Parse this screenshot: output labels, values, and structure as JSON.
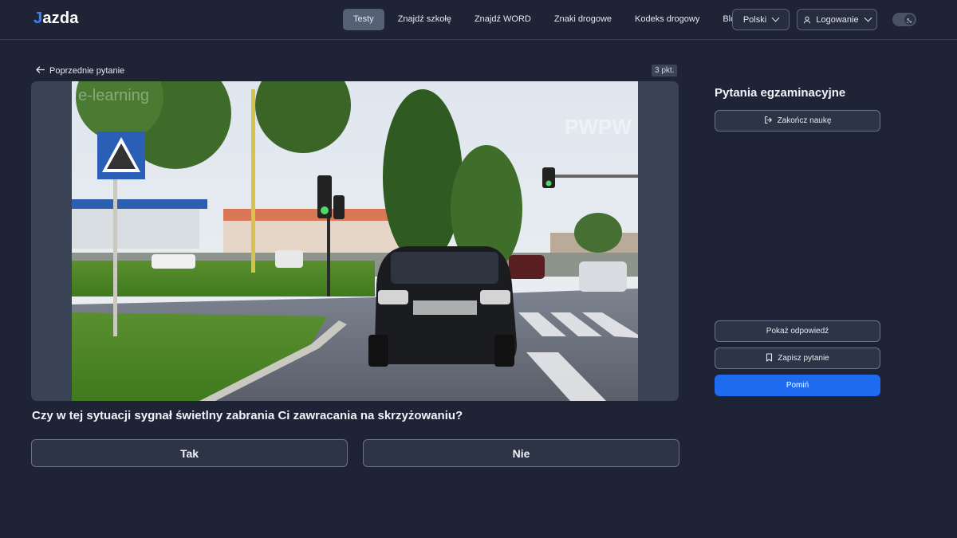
{
  "header": {
    "logo": {
      "mark": "J",
      "text": "azda"
    },
    "nav": [
      {
        "label": "Testy",
        "active": true
      },
      {
        "label": "Znajdź szkołę"
      },
      {
        "label": "Znajdź WORD"
      },
      {
        "label": "Znaki drogowe"
      },
      {
        "label": "Kodeks drogowy"
      },
      {
        "label": "Blog"
      }
    ],
    "language": "Polski",
    "login": "Logowanie",
    "theme_toggle_icon": "moon-icon"
  },
  "question": {
    "back_label": "Poprzednie pytanie",
    "points": "3 pkt.",
    "text": "Czy w tej sytuacji sygnał świetlny zabrania Ci zawracania na skrzyżowaniu?",
    "answers": [
      "Tak",
      "Nie"
    ],
    "image_watermarks": [
      "e-learning",
      "PWPW"
    ]
  },
  "sidebar": {
    "title": "Pytania egzaminacyjne",
    "finish_label": "Zakończ naukę",
    "show_answer_label": "Pokaż odpowiedź",
    "save_label": "Zapisz pytanie",
    "skip_label": "Pomiń"
  },
  "colors": {
    "background": "#1e2435",
    "card": "#3a4356",
    "accent": "#1f6bf0",
    "logo_mark": "#3b82f6"
  }
}
